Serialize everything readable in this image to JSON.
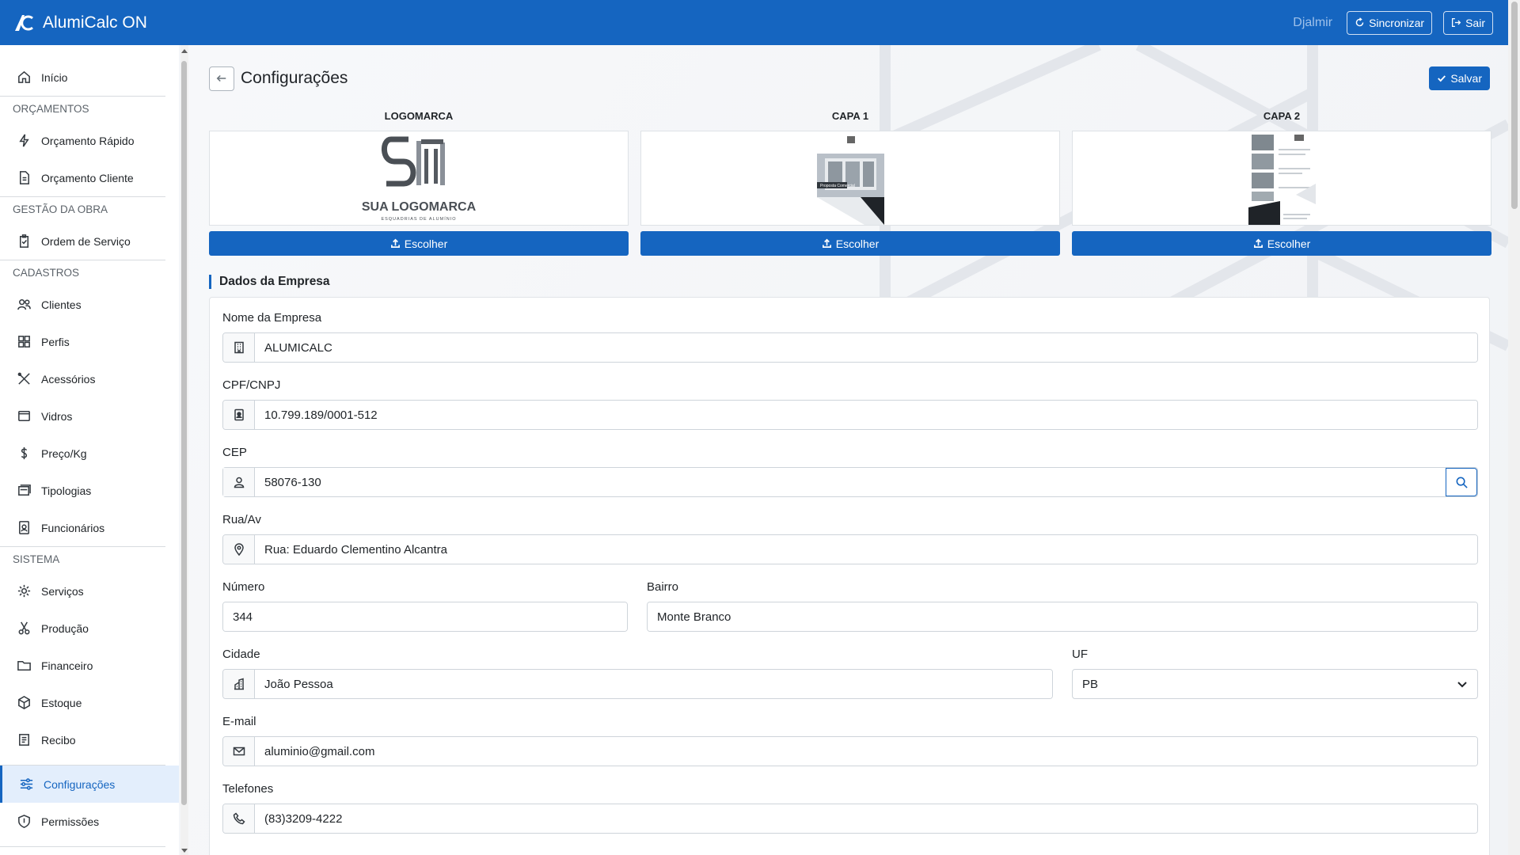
{
  "app": {
    "title": "AlumiCalc ON"
  },
  "topbar": {
    "user": "Djalmir",
    "sync_label": "Sincronizar",
    "exit_label": "Sair"
  },
  "sidebar": {
    "home": "Início",
    "sections": {
      "orcamentos": "ORÇAMENTOS",
      "gestao": "GESTÃO DA OBRA",
      "cadastros": "CADASTROS",
      "sistema": "SISTEMA"
    },
    "items": {
      "orcamento_rapido": "Orçamento Rápido",
      "orcamento_cliente": "Orçamento Cliente",
      "ordem_servico": "Ordem de Serviço",
      "clientes": "Clientes",
      "perfis": "Perfis",
      "acessorios": "Acessórios",
      "vidros": "Vidros",
      "preco_kg": "Preço/Kg",
      "tipologias": "Tipologias",
      "funcionarios": "Funcionários",
      "servicos": "Serviços",
      "producao": "Produção",
      "financeiro": "Financeiro",
      "estoque": "Estoque",
      "recibo": "Recibo",
      "configuracoes": "Configurações",
      "permissoes": "Permissões"
    }
  },
  "page": {
    "title": "Configurações",
    "save_label": "Salvar",
    "images": {
      "logo_title": "LOGOMARCA",
      "capa1_title": "CAPA 1",
      "capa2_title": "CAPA 2",
      "choose_label": "Escolher",
      "logo_text": "SUA LOGOMARCA",
      "logo_subtext": "ESQUADRIAS DE ALUMÍNIO",
      "capa1_banner": "Proposta Comercial"
    },
    "section_title": "Dados da Empresa",
    "form": {
      "nome_label": "Nome da Empresa",
      "nome_value": "ALUMICALC",
      "cnpj_label": "CPF/CNPJ",
      "cnpj_value": "10.799.189/0001-512",
      "cep_label": "CEP",
      "cep_value": "58076-130",
      "rua_label": "Rua/Av",
      "rua_value": "Rua: Eduardo Clementino Alcantra",
      "numero_label": "Número",
      "numero_value": "344",
      "bairro_label": "Bairro",
      "bairro_value": "Monte Branco",
      "cidade_label": "Cidade",
      "cidade_value": "João Pessoa",
      "uf_label": "UF",
      "uf_value": "PB",
      "email_label": "E-mail",
      "email_value": "aluminio@gmail.com",
      "telefones_label": "Telefones",
      "telefones_value": "(83)3209-4222"
    }
  },
  "colors": {
    "primary": "#1565c0",
    "active_bg": "#e3eefc"
  }
}
